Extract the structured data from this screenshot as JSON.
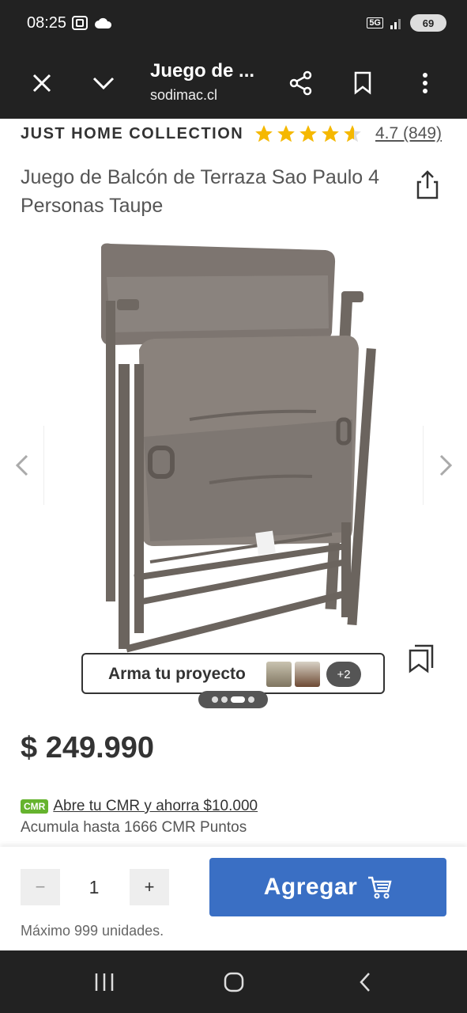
{
  "status": {
    "time": "08:25",
    "network": "5G",
    "battery": "69"
  },
  "toolbar": {
    "title": "Juego de ...",
    "url": "sodimac.cl"
  },
  "product": {
    "brand": "JUST HOME COLLECTION",
    "rating_text": "4.7 (849)",
    "rating_value": 4.7,
    "title": "Juego de Balcón de Terraza Sao Paulo 4 Personas Taupe",
    "price": "$ 249.990"
  },
  "carousel": {
    "project_label": "Arma tu proyecto",
    "more_count": "+2",
    "active_dot": 3,
    "dot_count": 4
  },
  "cmr": {
    "badge": "CMR",
    "link": "Abre tu CMR y ahorra $10.000",
    "points": "Acumula hasta 1666 CMR Puntos"
  },
  "cart": {
    "minus": "−",
    "quantity": "1",
    "plus": "+",
    "add_label": "Agregar",
    "max_units": "Máximo 999 unidades."
  },
  "colors": {
    "accent": "#3a6fc4",
    "star": "#f5b800",
    "cmr_green": "#65b32e",
    "chrome": "#222222"
  }
}
